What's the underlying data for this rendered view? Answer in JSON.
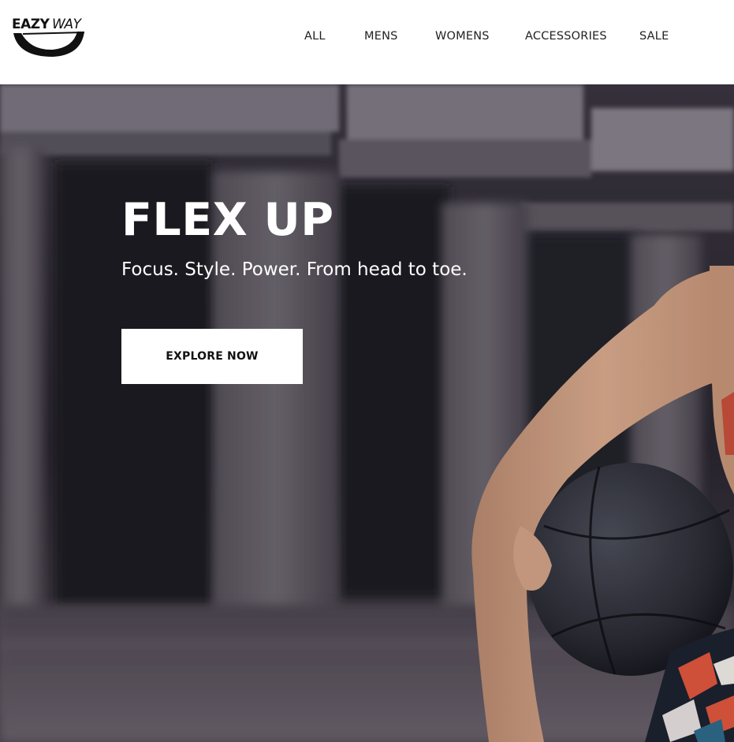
{
  "brand": {
    "name": "EAZYWAY",
    "logo_icon": "swoosh-logo"
  },
  "nav": {
    "items": [
      {
        "label": "ALL"
      },
      {
        "label": "MENS"
      },
      {
        "label": "WOMENS"
      },
      {
        "label": "ACCESSORIES"
      },
      {
        "label": "SALE"
      }
    ]
  },
  "hero": {
    "title": "FLEX UP",
    "subtitle": "Focus. Style. Power. From head to toe.",
    "cta_label": "EXPLORE NOW",
    "image_subject": "athlete-with-basketball"
  },
  "colors": {
    "header_bg": "#ffffff",
    "nav_text": "#222222",
    "hero_text": "#ffffff",
    "button_bg": "#ffffff",
    "button_text": "#111111"
  }
}
